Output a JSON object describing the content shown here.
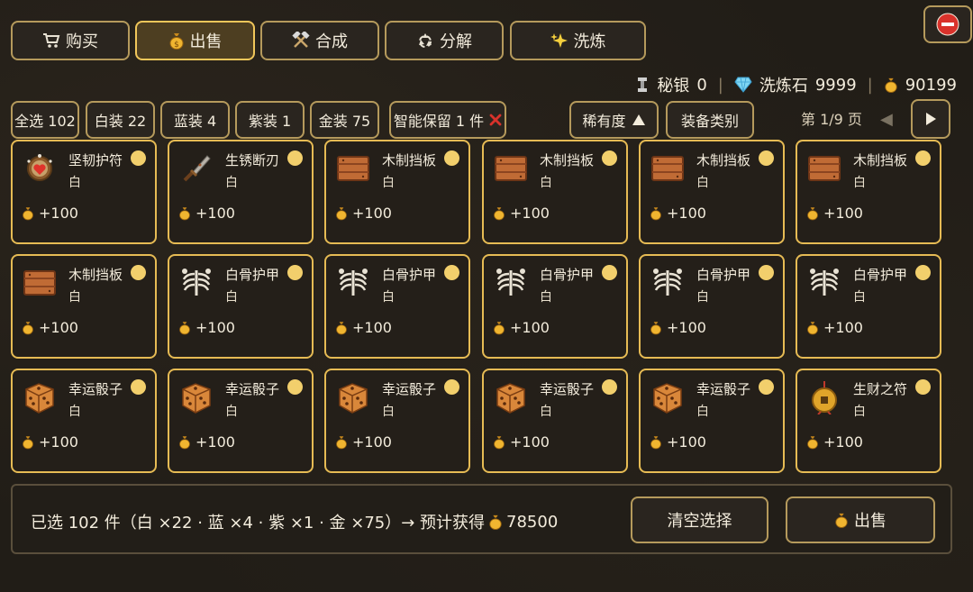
{
  "tabs": [
    {
      "label": "购买",
      "icon": "cart-icon"
    },
    {
      "label": "出售",
      "icon": "money-bag-icon",
      "active": true
    },
    {
      "label": "合成",
      "icon": "crossed-hammers-icon"
    },
    {
      "label": "分解",
      "icon": "recycle-icon"
    },
    {
      "label": "洗炼",
      "icon": "sparkles-icon"
    }
  ],
  "resources": {
    "mithril_label": "秘银",
    "mithril_value": "0",
    "stone_label": "洗炼石",
    "stone_value": "9999",
    "gold_value": "90199"
  },
  "filters": [
    {
      "label": "全选 102"
    },
    {
      "label": "白装 22"
    },
    {
      "label": "蓝装 4"
    },
    {
      "label": "紫装 1"
    },
    {
      "label": "金装 75"
    },
    {
      "label": "智能保留 1 件"
    }
  ],
  "sort": {
    "rarity_label": "稀有度",
    "type_label": "装备类别"
  },
  "pager": {
    "label": "第 1/9 页"
  },
  "items": [
    {
      "name": "坚韧护符",
      "rarity": "白",
      "price": "+100",
      "icon": "amulet-heart-icon"
    },
    {
      "name": "生锈断刃",
      "rarity": "白",
      "price": "+100",
      "icon": "rusty-blade-icon"
    },
    {
      "name": "木制挡板",
      "rarity": "白",
      "price": "+100",
      "icon": "wooden-shield-icon"
    },
    {
      "name": "木制挡板",
      "rarity": "白",
      "price": "+100",
      "icon": "wooden-shield-icon"
    },
    {
      "name": "木制挡板",
      "rarity": "白",
      "price": "+100",
      "icon": "wooden-shield-icon"
    },
    {
      "name": "木制挡板",
      "rarity": "白",
      "price": "+100",
      "icon": "wooden-shield-icon"
    },
    {
      "name": "木制挡板",
      "rarity": "白",
      "price": "+100",
      "icon": "wooden-shield-icon"
    },
    {
      "name": "白骨护甲",
      "rarity": "白",
      "price": "+100",
      "icon": "bone-armor-icon"
    },
    {
      "name": "白骨护甲",
      "rarity": "白",
      "price": "+100",
      "icon": "bone-armor-icon"
    },
    {
      "name": "白骨护甲",
      "rarity": "白",
      "price": "+100",
      "icon": "bone-armor-icon"
    },
    {
      "name": "白骨护甲",
      "rarity": "白",
      "price": "+100",
      "icon": "bone-armor-icon"
    },
    {
      "name": "白骨护甲",
      "rarity": "白",
      "price": "+100",
      "icon": "bone-armor-icon"
    },
    {
      "name": "幸运骰子",
      "rarity": "白",
      "price": "+100",
      "icon": "dice-icon"
    },
    {
      "name": "幸运骰子",
      "rarity": "白",
      "price": "+100",
      "icon": "dice-icon"
    },
    {
      "name": "幸运骰子",
      "rarity": "白",
      "price": "+100",
      "icon": "dice-icon"
    },
    {
      "name": "幸运骰子",
      "rarity": "白",
      "price": "+100",
      "icon": "dice-icon"
    },
    {
      "name": "幸运骰子",
      "rarity": "白",
      "price": "+100",
      "icon": "dice-icon"
    },
    {
      "name": "生财之符",
      "rarity": "白",
      "price": "+100",
      "icon": "coin-charm-icon"
    }
  ],
  "summary": {
    "text": "已选 102 件（白 ×22 · 蓝 ×4 · 紫 ×1 · 金 ×75）→ 预计获得",
    "value": "78500"
  },
  "actions": {
    "clear_label": "清空选择",
    "sell_label": "出售"
  },
  "colors": {
    "accent": "#e6bb54",
    "active_tab": "#4d3e21",
    "panel": "#241f19",
    "remove_x": "#d9322b"
  }
}
